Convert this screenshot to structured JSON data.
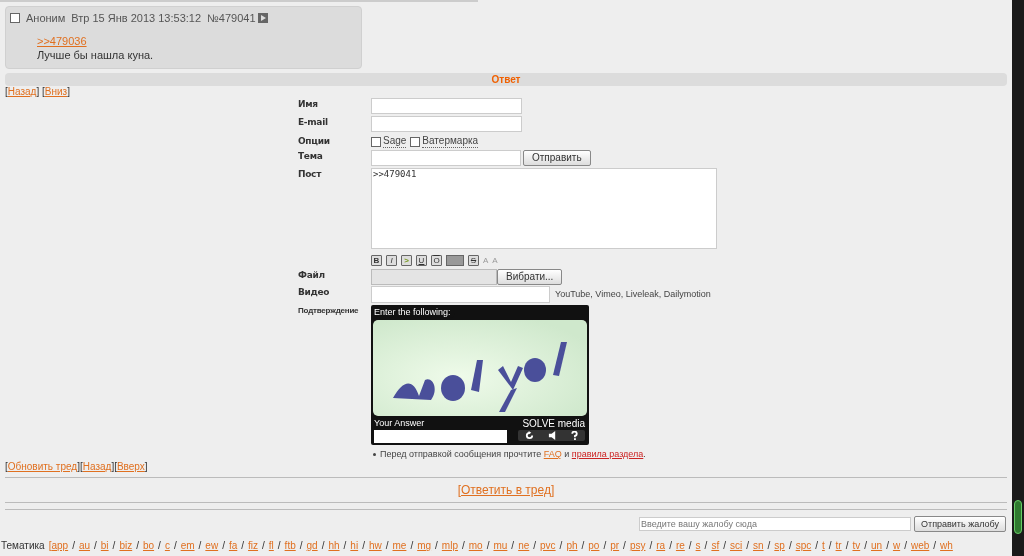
{
  "post": {
    "checked": false,
    "author": "Аноним",
    "date": "Втр 15 Янв 2013 13:53:12",
    "number": "№479041",
    "reply_link": ">>479036",
    "text": "Лучше бы нашла куна."
  },
  "reply_bar": "Ответ",
  "nav_top": [
    {
      "before": "[",
      "label": "Назад",
      "after": "]"
    },
    {
      "before": " [",
      "label": "Вниз",
      "after": "]"
    }
  ],
  "form": {
    "name": {
      "label": "Имя"
    },
    "email": {
      "label": "E-mail"
    },
    "options": {
      "label": "Опции",
      "items": [
        {
          "label": "Sage",
          "checked": false
        },
        {
          "label": "Ватермарка",
          "checked": false
        }
      ]
    },
    "subject": {
      "label": "Тема",
      "button": "Отправить"
    },
    "post": {
      "label": "Пост",
      "value": ">>479041\n"
    },
    "toolbar": [
      {
        "kind": "letter",
        "label": "B"
      },
      {
        "kind": "italic",
        "label": "I"
      },
      {
        "kind": "quote",
        "label": ">"
      },
      {
        "kind": "underline",
        "label": "U"
      },
      {
        "kind": "overline",
        "label": "O"
      },
      {
        "kind": "spoiler"
      },
      {
        "kind": "strike",
        "label": "S"
      },
      {
        "kind": "sup",
        "label": "A"
      },
      {
        "kind": "sub",
        "label": "A"
      }
    ],
    "file": {
      "label": "Файл",
      "button": "Вибрати..."
    },
    "video": {
      "label": "Видео",
      "hint": "YouTube, Vimeo, Liveleak, Dailymotion"
    },
    "captcha": {
      "label": "Подтверждение",
      "prompt": "Enter the following:",
      "answer_label": "Your Answer",
      "brand": "SOLVE media"
    },
    "notice_parts": [
      {
        "kind": "text",
        "text": "Перед отправкой сообщения прочтите "
      },
      {
        "kind": "link",
        "text": "FAQ",
        "color": "#e07020"
      },
      {
        "kind": "text",
        "text": " и "
      },
      {
        "kind": "link",
        "text": "правила раздела",
        "color": "#cc2222"
      },
      {
        "kind": "text",
        "text": "."
      }
    ]
  },
  "nav_bottom": [
    {
      "before": "[",
      "label": "Обновить тред",
      "after": "]"
    },
    {
      "before": "[",
      "label": "Назад",
      "after": "]"
    },
    {
      "before": "[",
      "label": "Вверх",
      "after": "]"
    }
  ],
  "reply_thread": {
    "before": "[",
    "label": "Ответить в тред",
    "after": "]"
  },
  "complaint": {
    "placeholder": "Введите вашу жалобу сюда",
    "button": "Отправить жалобу"
  },
  "boards": {
    "label": "Тематика",
    "open": "[",
    "separator": "/",
    "items": [
      "app",
      "au",
      "bi",
      "biz",
      "bo",
      "c",
      "em",
      "ew",
      "fa",
      "fiz",
      "fl",
      "ftb",
      "gd",
      "hh",
      "hi",
      "hw",
      "me",
      "mg",
      "mlp",
      "mo",
      "mu",
      "ne",
      "pvc",
      "ph",
      "po",
      "pr",
      "psy",
      "ra",
      "re",
      "s",
      "sf",
      "sci",
      "sn",
      "sp",
      "spc",
      "t",
      "tr",
      "tv",
      "un",
      "w",
      "web",
      "wh"
    ]
  }
}
